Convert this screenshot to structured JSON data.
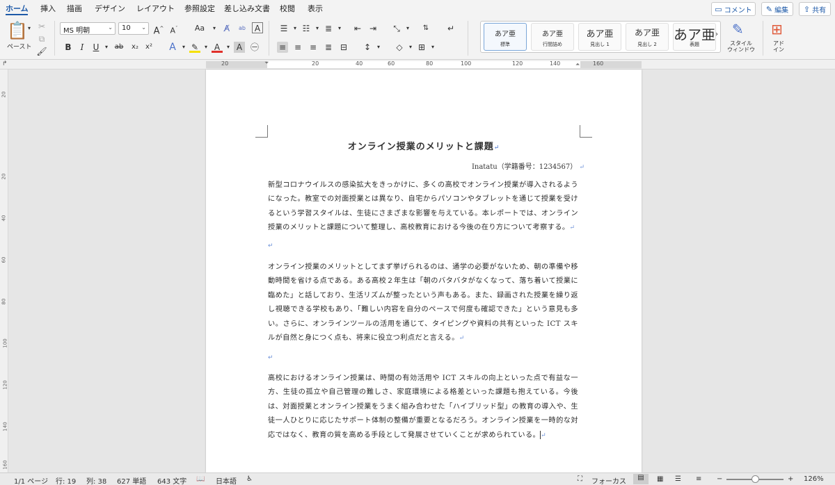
{
  "tabs": [
    "ホーム",
    "挿入",
    "描画",
    "デザイン",
    "レイアウト",
    "参照設定",
    "差し込み文書",
    "校閲",
    "表示"
  ],
  "top_buttons": {
    "comment": "コメント",
    "edit": "編集",
    "share": "共有"
  },
  "ribbon": {
    "paste_label": "ペースト",
    "font_name": "MS 明朝",
    "font_size": "10",
    "font_grow": "A",
    "font_shrink": "A",
    "change_case": "Aa",
    "bold": "B",
    "italic": "I",
    "underline": "U",
    "strike": "ab",
    "subscript": "x₂",
    "superscript": "x²",
    "styles": [
      {
        "sample": "あア亜",
        "label": "標準"
      },
      {
        "sample": "あア亜",
        "label": "行間詰め"
      },
      {
        "sample": "あア亜",
        "label": "見出し 1"
      },
      {
        "sample": "あア亜",
        "label": "見出し 2"
      },
      {
        "sample": "あア亜",
        "label": "表題"
      }
    ],
    "style_window": "スタイル\nウィンドウ",
    "addins": "アド\nイン"
  },
  "ruler_h": [
    "20",
    "20",
    "40",
    "60",
    "80",
    "100",
    "120",
    "140",
    "160"
  ],
  "ruler_v": [
    "20",
    "20",
    "40",
    "60",
    "80",
    "100",
    "120",
    "140",
    "160"
  ],
  "document": {
    "title": "オンライン授業のメリットと課題",
    "author": "Inatatu（学籍番号：1234567）",
    "paragraphs": [
      "新型コロナウイルスの感染拡大をきっかけに、多くの高校でオンライン授業が導入されるようになった。教室での対面授業とは異なり、自宅からパソコンやタブレットを通じて授業を受けるという学習スタイルは、生徒にさまざまな影響を与えている。本レポートでは、オンライン授業のメリットと課題について整理し、高校教育における今後の在り方について考察する。",
      "オンライン授業のメリットとしてまず挙げられるのは、通学の必要がないため、朝の準備や移動時間を省ける点である。ある高校２年生は「朝のバタバタがなくなって、落ち着いて授業に臨めた」と話しており、生活リズムが整ったという声もある。また、録画された授業を繰り返し視聴できる学校もあり、「難しい内容を自分のペースで何度も確認できた」という意見も多い。さらに、オンラインツールの活用を通じて、タイピングや資料の共有といった ICT スキルが自然と身につく点も、将来に役立つ利点だと言える。",
      "高校におけるオンライン授業は、時間の有効活用や ICT スキルの向上といった点で有益な一方、生徒の孤立や自己管理の難しさ、家庭環境による格差といった課題も抱えている。今後は、対面授業とオンライン授業をうまく組み合わせた「ハイブリッド型」の教育の導入や、生徒一人ひとりに応じたサポート体制の整備が重要となるだろう。オンライン授業を一時的な対応ではなく、教育の質を高める手段として発展させていくことが求められている。"
    ],
    "para_mark": "↵"
  },
  "status": {
    "page": "1/1 ページ",
    "line": "行: 19",
    "column": "列: 38",
    "words": "627 単語",
    "chars": "643 文字",
    "language": "日本語",
    "focus": "フォーカス",
    "zoom": "126%",
    "zoom_minus": "−",
    "zoom_plus": "+"
  }
}
